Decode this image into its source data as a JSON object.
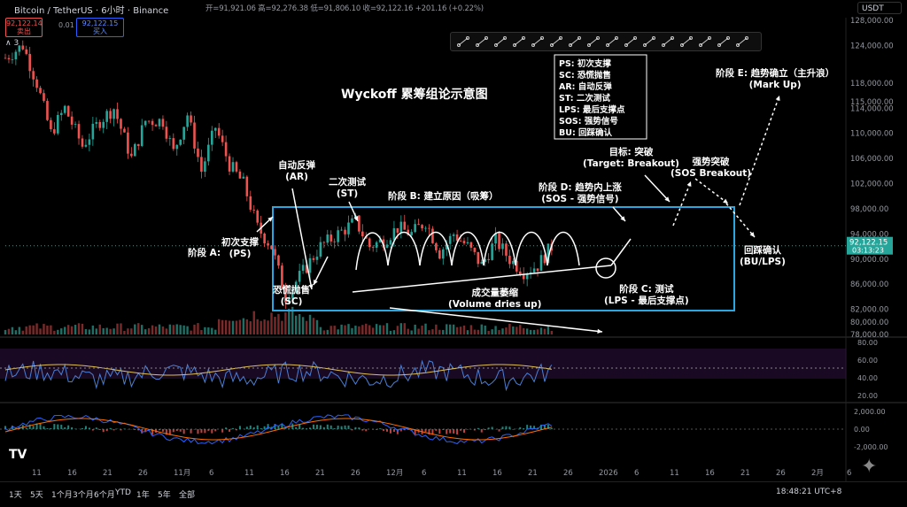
{
  "header": {
    "symbol": "Bitcoin / TetherUS · 6小时 · Binance",
    "ohlc": "开=91,921.06 高=92,276.38 低=91,806.10 收=92,122.16 +201.16 (+0.22%)",
    "sell_price": "92,122.14",
    "sell_label": "卖出",
    "spread": "0.01",
    "buy_price": "92,122.15",
    "buy_label": "买入",
    "indicator_count": "3",
    "currency": "USDT"
  },
  "colors": {
    "up": "#26a69a",
    "down": "#ef5350",
    "box": "#2aa7e0",
    "rsi_line": "#4a7fd6",
    "rsi_ma": "#e0c050"
  },
  "chart_data": {
    "type": "candlestick",
    "title": "Wyckoff 累筹组论示意图",
    "y_axis": {
      "ylim": [
        78000,
        127000
      ],
      "ticks": [
        128000,
        124000,
        118000,
        115000,
        114000,
        110000,
        106000,
        102000,
        98000,
        94000,
        90000,
        86000,
        82000,
        80000,
        78000
      ],
      "tick_labels": [
        "128,000.00",
        "124,000.00",
        "118,000.00",
        "115,000.00",
        "114,000.00",
        "110,000.00",
        "106,000.00",
        "102,000.00",
        "98,000.00",
        "94,000.00",
        "90,000.00",
        "86,000.00",
        "82,000.00",
        "80,000.00",
        "78,000.00"
      ]
    },
    "x_axis": {
      "tick_labels": [
        "11",
        "16",
        "21",
        "26",
        "11月",
        "6",
        "11",
        "16",
        "21",
        "26",
        "12月",
        "6",
        "11",
        "16",
        "21",
        "26",
        "2026",
        "6",
        "11",
        "16",
        "21",
        "26",
        "2月",
        "6"
      ],
      "xlim": [
        0,
        240
      ]
    },
    "last_price": "92,122.15",
    "countdown": "03:13:23",
    "path_x": [
      0,
      5,
      9,
      13,
      17,
      22,
      27,
      31,
      36,
      40,
      45,
      48,
      52,
      56,
      60,
      64,
      68,
      72,
      76,
      80,
      85,
      90,
      95,
      100,
      104,
      108,
      112,
      116,
      120,
      124,
      128,
      132,
      136,
      140,
      144,
      148,
      152,
      156,
      160,
      164,
      168,
      172,
      175,
      178,
      182,
      186,
      190,
      194,
      198,
      202,
      206,
      210,
      214,
      218,
      222,
      226,
      230,
      234,
      238,
      240
    ],
    "path_y": [
      122000,
      124000,
      118000,
      110000,
      114000,
      108000,
      112000,
      114000,
      106000,
      112000,
      112000,
      107000,
      113000,
      104000,
      111000,
      105000,
      102000,
      95000,
      92000,
      84000,
      88000,
      92000,
      94000,
      96000,
      92000,
      93000,
      95000,
      94000,
      96000,
      91000,
      94000,
      92000,
      89000,
      93000,
      90000,
      88000,
      89000,
      92000,
      89000,
      90000,
      87000,
      88000,
      89000,
      91000,
      95000,
      96000,
      91000,
      94000,
      94000,
      92000,
      92000,
      92000,
      92000,
      92000,
      92000,
      92000,
      92000,
      92000,
      92000,
      92000
    ],
    "annotations": {
      "phase_a": "阶段 A:",
      "ps": "初次支撑\n(PS)",
      "ar": "自动反弹\n(AR)",
      "st": "二次测试\n(ST)",
      "sc": "恐慌抛售\n(SC)",
      "phase_b": "阶段 B: 建立原因（吸筹）",
      "volume": "成交量萎缩\n(Volume dries up)",
      "phase_c": "阶段 C: 测试\n(LPS - 最后支撑点)",
      "phase_d": "阶段 D: 趋势内上涨\n(SOS - 强势信号)",
      "target": "目标: 突破\n(Target: Breakout)",
      "sos": "强势突破\n(SOS Breakout)",
      "bu": "回踩确认\n(BU/LPS)",
      "phase_e": "阶段 E: 趋势确立（主升浪）\n(Mark Up)",
      "legend": [
        "PS: 初次支撑",
        "SC: 恐慌抛售",
        "AR: 自动反弹",
        "ST: 二次测试",
        "LPS: 最后支撑点",
        "SOS: 强势信号",
        "BU: 回踩确认"
      ]
    },
    "rsi_pane": {
      "ticks": [
        "80.00",
        "60.00",
        "40.00",
        "20.00"
      ]
    },
    "macd_pane": {
      "ticks": [
        "2,000.00",
        "0.00",
        "-2,000.00"
      ]
    }
  },
  "timeframes": [
    "1天",
    "5天",
    "1个月",
    "3个月",
    "6个月",
    "YTD",
    "1年",
    "5年",
    "全部"
  ],
  "clock": "18:48:21 UTC+8",
  "logo": "TV"
}
